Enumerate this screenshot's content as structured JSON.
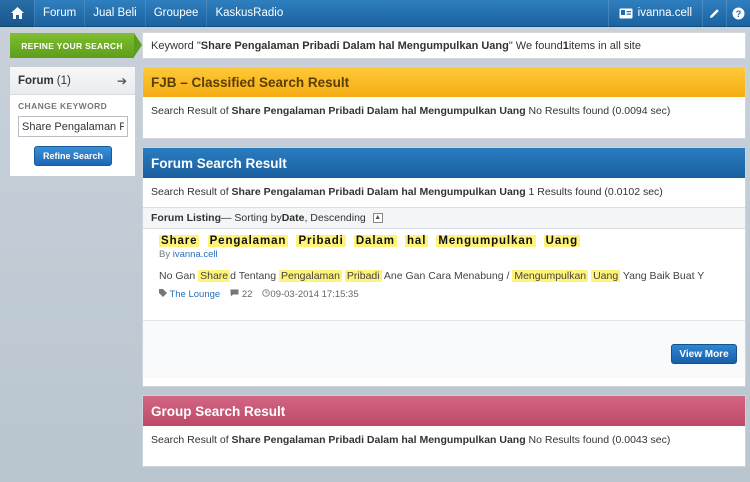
{
  "navbar": {
    "links": [
      "Forum",
      "Jual Beli",
      "Groupee",
      "KaskusRadio"
    ],
    "username": "ivanna.cell"
  },
  "sidebar": {
    "refine_tab": "REFINE YOUR SEARCH",
    "forum_label": "Forum",
    "forum_count": "(1)",
    "change_keyword": "CHANGE KEYWORD",
    "keyword_value": "Share Pengalaman Pribadi Dalam hal Mengumpulkan Uang",
    "refine_button": "Refine Search"
  },
  "keyword_strip": {
    "prefix": "Keyword \"",
    "keyword": "Share Pengalaman Pribadi Dalam hal Mengumpulkan Uang",
    "middle": "\" We found ",
    "count": "1",
    "suffix": " items in all site"
  },
  "fjb": {
    "title": "FJB – Classified Search Result",
    "prefix": "Search Result of ",
    "keyword": "Share Pengalaman Pribadi Dalam hal Mengumpulkan Uang",
    "result": " No Results found (0.0094 sec)"
  },
  "forum": {
    "title": "Forum Search Result",
    "prefix": "Search Result of ",
    "keyword": "Share Pengalaman Pribadi Dalam hal Mengumpulkan Uang",
    "result": " 1 Results found (0.0102 sec)",
    "listing_label": "Forum Listing",
    "sorting_text": " — Sorting by ",
    "sort_field": "Date",
    "sort_order": ", Descending",
    "thread": {
      "title_words": [
        "Share",
        "Pengalaman",
        "Pribadi",
        "Dalam",
        "hal",
        "Mengumpulkan",
        "Uang"
      ],
      "by_label": "By ",
      "author": "ivanna.cell",
      "snippet": {
        "s1": "No Gan ",
        "h1": "Share",
        "s2": "d Tentang ",
        "h2": "Pengalaman",
        "h3": "Pribadi",
        "s3": " Ane Gan Cara Menabung / ",
        "h4": "Mengumpulkan",
        "h5": "Uang",
        "s4": " Yang Baik Buat Y"
      },
      "forum_name": "The Lounge",
      "comments": "22",
      "date": "09-03-2014 17:15:35"
    },
    "view_more": "View More"
  },
  "group": {
    "title": "Group Search Result",
    "prefix": "Search Result of ",
    "keyword": "Share Pengalaman Pribadi Dalam hal Mengumpulkan Uang",
    "result": " No Results found (0.0043 sec)"
  },
  "colors": {
    "navbar": "#1f6aab",
    "fjb_header": "#f7b21b",
    "forum_header": "#1f6aab",
    "group_header": "#c65271",
    "refine_tab": "#6aaa22",
    "highlight": "#fff37a"
  }
}
